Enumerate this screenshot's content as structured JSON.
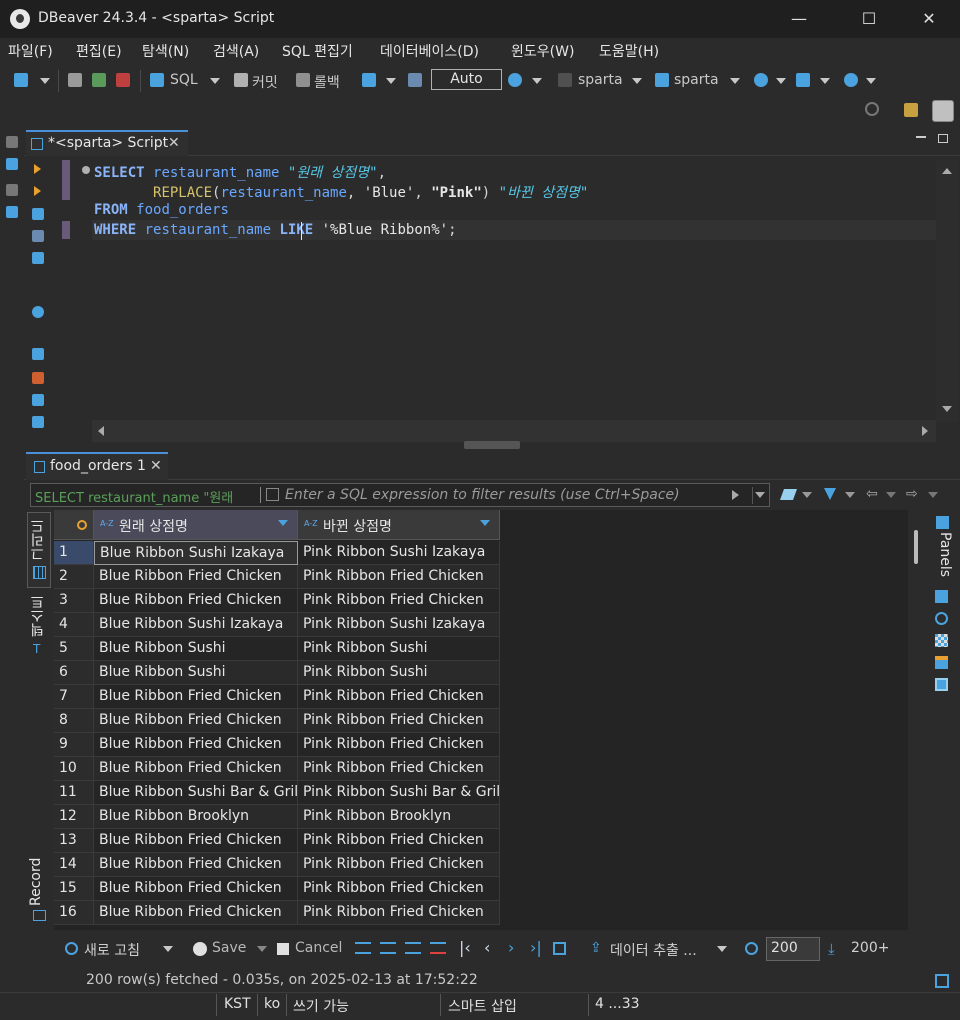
{
  "window": {
    "title": "DBeaver 24.3.4 - <sparta> Script",
    "minimize": "—",
    "maximize": "☐",
    "close": "✕"
  },
  "menu": [
    "파일(F)",
    "편집(E)",
    "탐색(N)",
    "검색(A)",
    "SQL 편집기",
    "데이터베이스(D)",
    "윈도우(W)",
    "도움말(H)"
  ],
  "toolbar": {
    "sql_label": "SQL",
    "commit_label": "커밋",
    "rollback_label": "롤백",
    "transaction_mode": "Auto",
    "datasource": "sparta",
    "schema": "sparta"
  },
  "editor": {
    "tab_label": "*<sparta> Script",
    "code_lines": [
      "SELECT restaurant_name \"원래 상점명\",",
      "       REPLACE(restaurant_name, 'Blue', \"Pink\") \"바뀐 상점명\"",
      "FROM food_orders",
      "WHERE restaurant_name LIKE '%Blue Ribbon%';"
    ]
  },
  "results": {
    "tab_label": "food_orders 1",
    "filter_prefix": "SELECT restaurant_name \"원래",
    "filter_placeholder": "Enter a SQL expression to filter results (use Ctrl+Space)",
    "side_tabs": {
      "grid": "그리드",
      "text": "텍스트",
      "record": "Record",
      "panels": "Panels"
    },
    "columns": [
      "원래 상점명",
      "바뀐 상점명"
    ],
    "rows": [
      [
        "1",
        "Blue Ribbon Sushi Izakaya",
        "Pink Ribbon Sushi Izakaya"
      ],
      [
        "2",
        "Blue Ribbon Fried Chicken",
        "Pink Ribbon Fried Chicken"
      ],
      [
        "3",
        "Blue Ribbon Fried Chicken",
        "Pink Ribbon Fried Chicken"
      ],
      [
        "4",
        "Blue Ribbon Sushi Izakaya",
        "Pink Ribbon Sushi Izakaya"
      ],
      [
        "5",
        "Blue Ribbon Sushi",
        "Pink Ribbon Sushi"
      ],
      [
        "6",
        "Blue Ribbon Sushi",
        "Pink Ribbon Sushi"
      ],
      [
        "7",
        "Blue Ribbon Fried Chicken",
        "Pink Ribbon Fried Chicken"
      ],
      [
        "8",
        "Blue Ribbon Fried Chicken",
        "Pink Ribbon Fried Chicken"
      ],
      [
        "9",
        "Blue Ribbon Fried Chicken",
        "Pink Ribbon Fried Chicken"
      ],
      [
        "10",
        "Blue Ribbon Fried Chicken",
        "Pink Ribbon Fried Chicken"
      ],
      [
        "11",
        "Blue Ribbon Sushi Bar & Grill",
        "Pink Ribbon Sushi Bar & Grill"
      ],
      [
        "12",
        "Blue Ribbon Brooklyn",
        "Pink Ribbon Brooklyn"
      ],
      [
        "13",
        "Blue Ribbon Fried Chicken",
        "Pink Ribbon Fried Chicken"
      ],
      [
        "14",
        "Blue Ribbon Fried Chicken",
        "Pink Ribbon Fried Chicken"
      ],
      [
        "15",
        "Blue Ribbon Fried Chicken",
        "Pink Ribbon Fried Chicken"
      ],
      [
        "16",
        "Blue Ribbon Fried Chicken",
        "Pink Ribbon Fried Chicken"
      ]
    ],
    "bottom": {
      "refresh": "새로 고침",
      "save": "Save",
      "cancel": "Cancel",
      "export": "데이터 추출 ...",
      "fetch_size": "200",
      "fetch_count": "200+"
    },
    "status": "200 row(s) fetched - 0.035s, on 2025-02-13 at 17:52:22"
  },
  "statusbar": {
    "timezone": "KST",
    "locale": "ko",
    "write_mode": "쓰기 가능",
    "insert_mode": "스마트 삽입",
    "position": "4 ...33"
  },
  "colors": {
    "accent": "#4a90d9",
    "keyword": "#8ab4f8",
    "function": "#d6c36a",
    "identifier": "#6aa7ff",
    "alias": "#57c7e6"
  }
}
